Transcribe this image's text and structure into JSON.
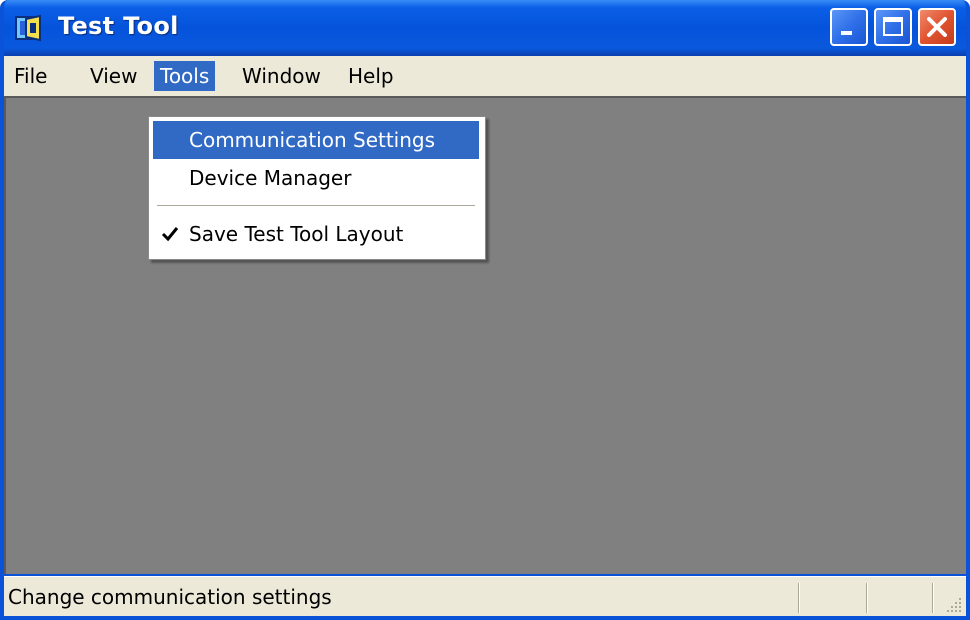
{
  "window": {
    "title": "Test Tool"
  },
  "menubar": {
    "items": [
      {
        "label": "File"
      },
      {
        "label": "View"
      },
      {
        "label": "Tools"
      },
      {
        "label": "Window"
      },
      {
        "label": "Help"
      }
    ],
    "active": "Tools"
  },
  "tools_menu": {
    "items": [
      {
        "label": "Communication Settings",
        "highlighted": true
      },
      {
        "label": "Device Manager"
      },
      {
        "label": "Save Test Tool Layout",
        "checked": true
      }
    ]
  },
  "statusbar": {
    "text": "Change communication settings"
  },
  "colors": {
    "titlebar": "#0553db",
    "highlight": "#316ac5",
    "client_bg": "#808080",
    "menu_bg": "#ece9d8",
    "close_button": "#e0532f"
  },
  "icons": {
    "app": "test-tool-app-icon",
    "minimize": "minimize-icon",
    "maximize": "maximize-icon",
    "close": "close-icon",
    "check": "checkmark-icon",
    "grip": "resize-grip-icon"
  }
}
